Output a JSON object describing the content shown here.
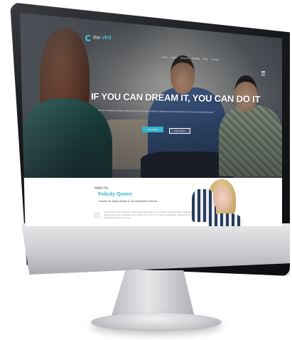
{
  "brand": {
    "logo_text": "the",
    "logo_accent": "vfrd",
    "accent_color": "#35b3cc"
  },
  "nav": {
    "items": [
      "Home",
      "About",
      "Services",
      "Portfolio",
      "Blog",
      "Contact"
    ]
  },
  "hero": {
    "headline": "IF YOU CAN DREAM IT, YOU CAN DO IT",
    "subline": "We are a creative company that believes in the power of ideas to transform the world around us and help businesses grow",
    "primary_button": "Get Started",
    "secondary_button": "Learn More"
  },
  "about": {
    "hello": "Hello I'm",
    "name": "Felicity Queen",
    "tagline": "I works for every kinds of our customers needs...",
    "bio": "Lorem ipsum dolor sit amet, consectetur adipisicing elit, to molestie mattis aenean vulputate aliquam sed tincidunt nisi ullamcorper lorem. Phasellus dictum felis vel nisi non eros viverra consectetur adipisicing elit sed do eiusmod tempor incididunt ut labore et dolore."
  },
  "icons": {
    "logo": "circle-logo-icon",
    "menu": "hamburger-menu-icon"
  }
}
